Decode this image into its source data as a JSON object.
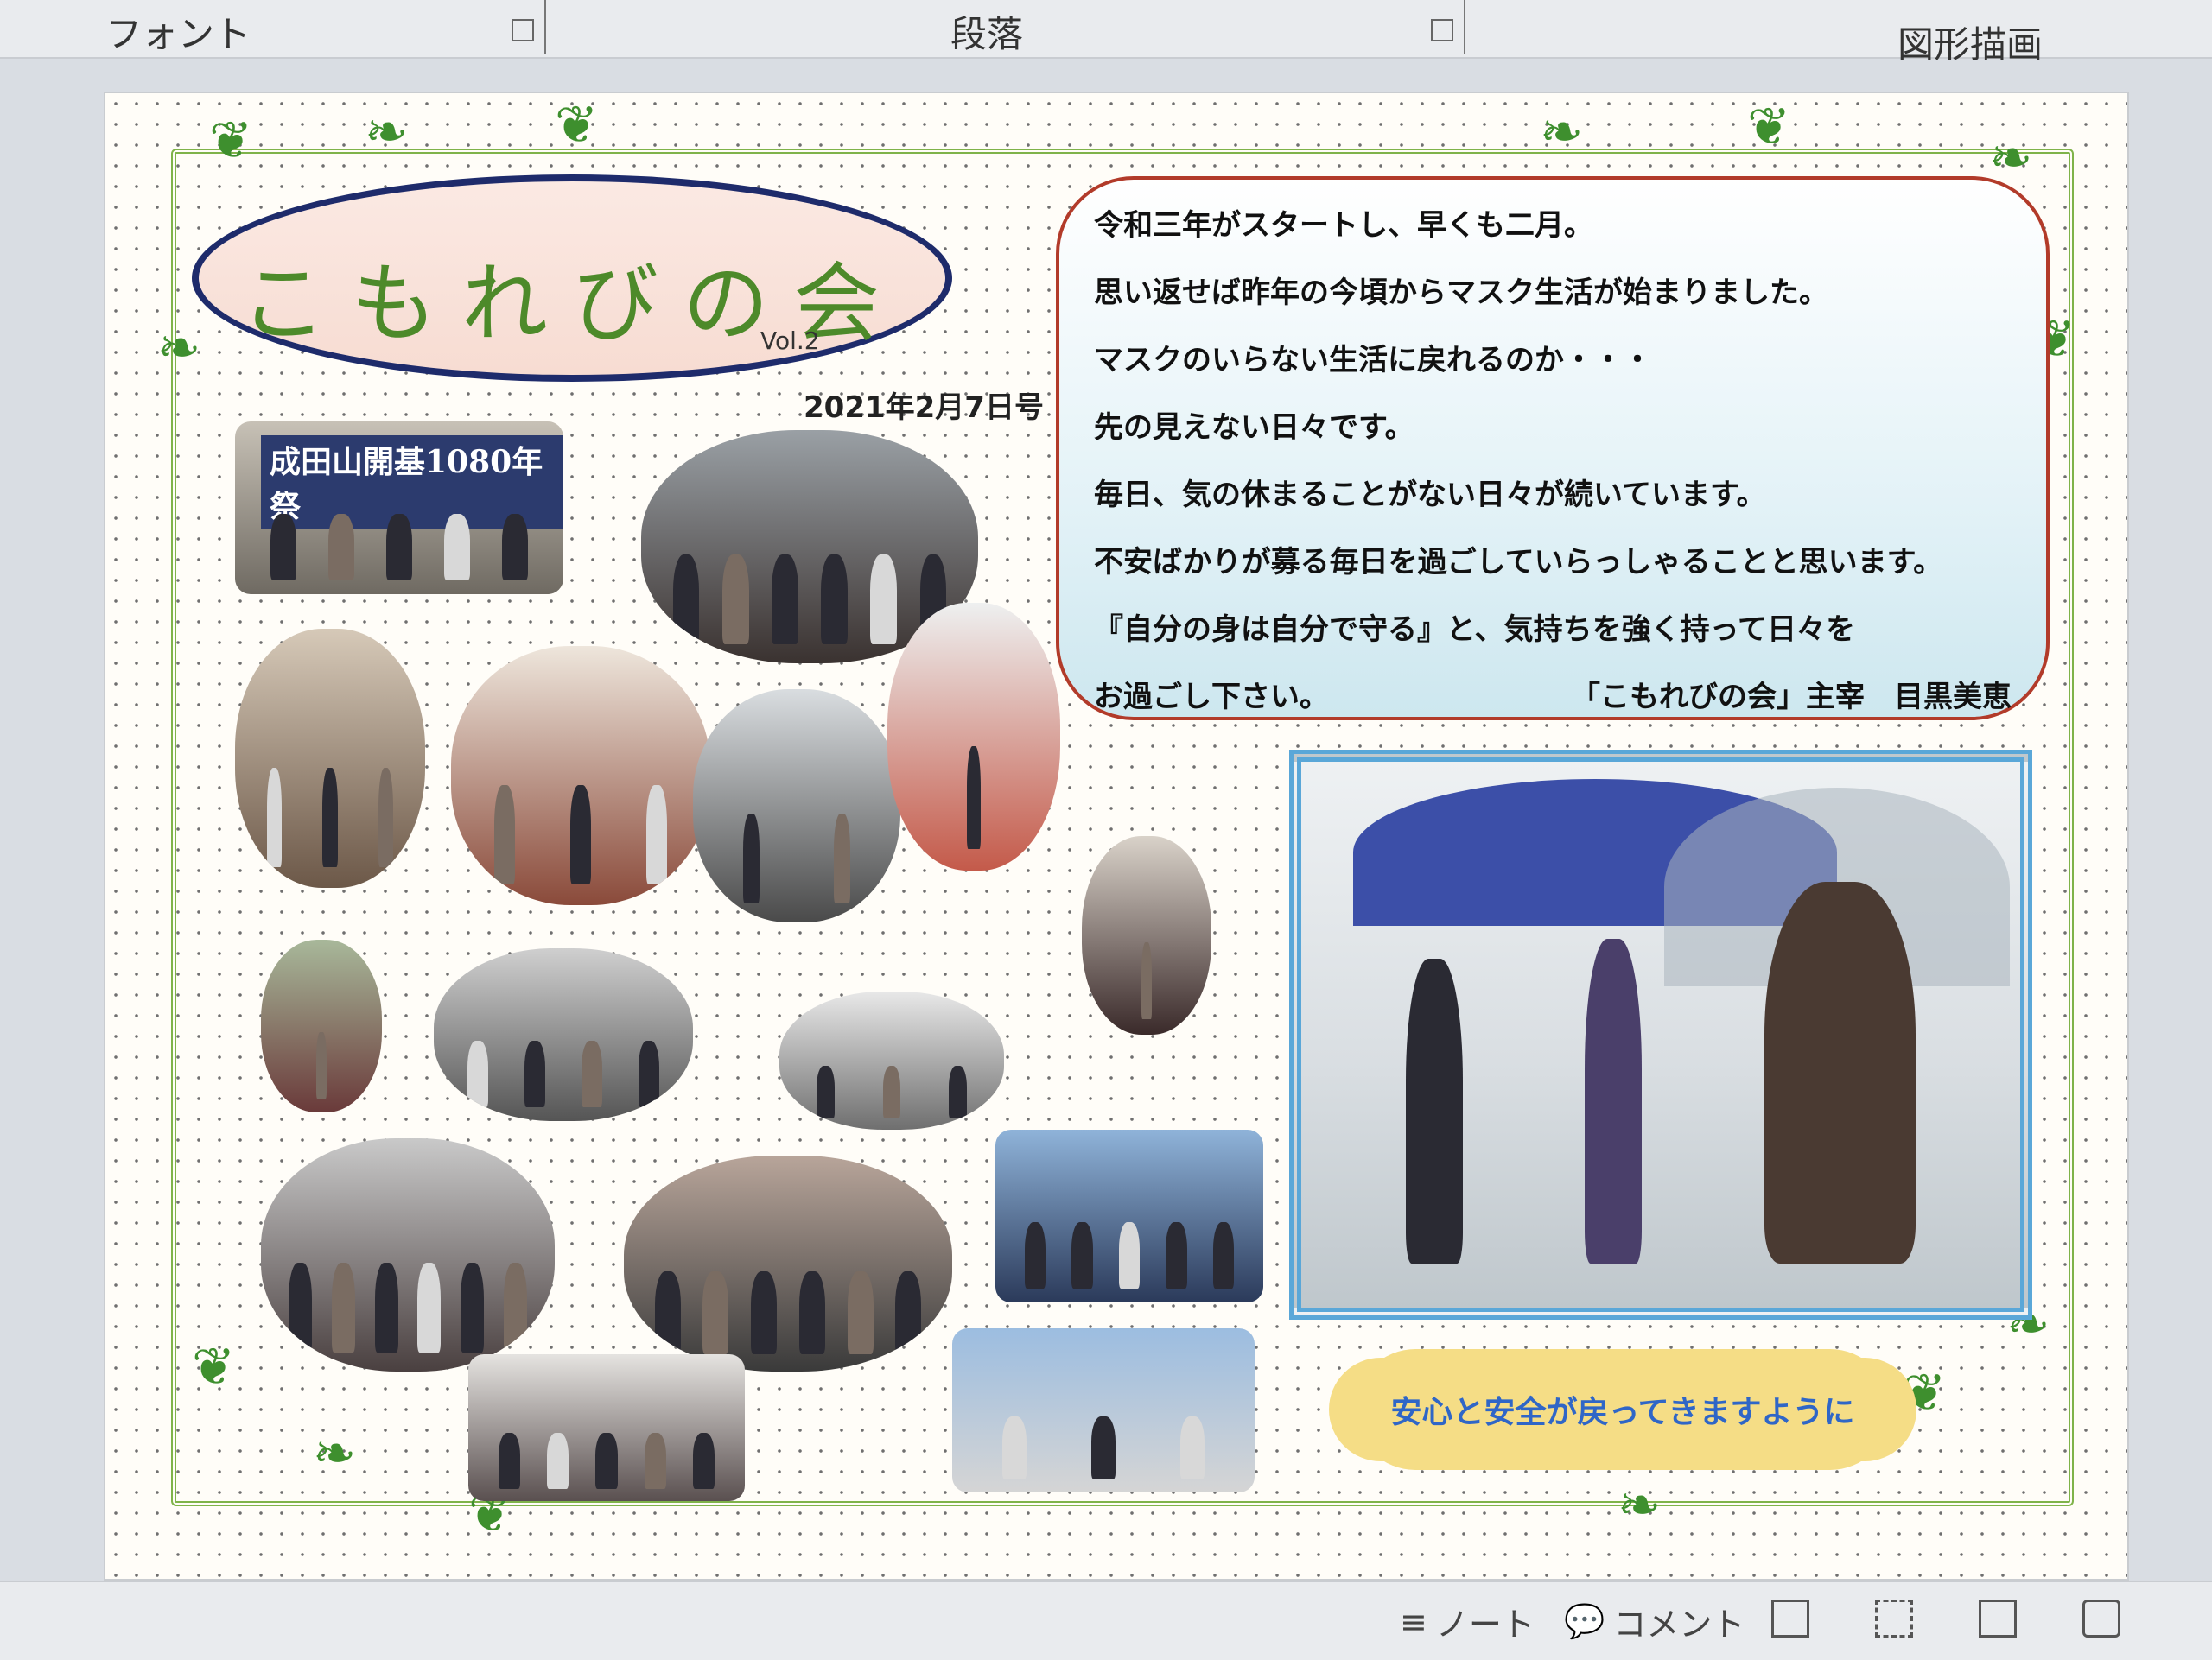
{
  "ribbon": {
    "groups": [
      "フォント",
      "段落",
      "図形描画"
    ]
  },
  "newsletter": {
    "title": "こもれびの会",
    "volume": "Vol.2",
    "date": "2021年2月7日号",
    "message_lines": [
      "令和三年がスタートし、早くも二月。",
      "思い返せば昨年の今頃からマスク生活が始まりました。",
      "マスクのいらない生活に戻れるのか・・・",
      "先の見えない日々です。",
      "毎日、気の休まることがない日々が続いています。",
      "不安ばかりが募る毎日を過ごしていらっしゃることと思います。",
      "『自分の身は自分で守る』と、気持ちを強く持って日々を"
    ],
    "message_last_left": "お過ごし下さい。",
    "message_signature": "「こもれびの会」主宰　目黒美恵",
    "photo_banner": "成田山開基1080年祭",
    "cloud_text": "安心と安全が戻ってきますように"
  },
  "statusbar": {
    "notes_label": "ノート",
    "comments_label": "コメント"
  },
  "colors": {
    "title_green": "#4d8a2a",
    "oval_border": "#1e2b6b",
    "message_border": "#b23b2a",
    "cloud_fill": "#f5dd86",
    "cloud_text": "#2f66c7",
    "photo_frame": "#5aa7d8"
  }
}
